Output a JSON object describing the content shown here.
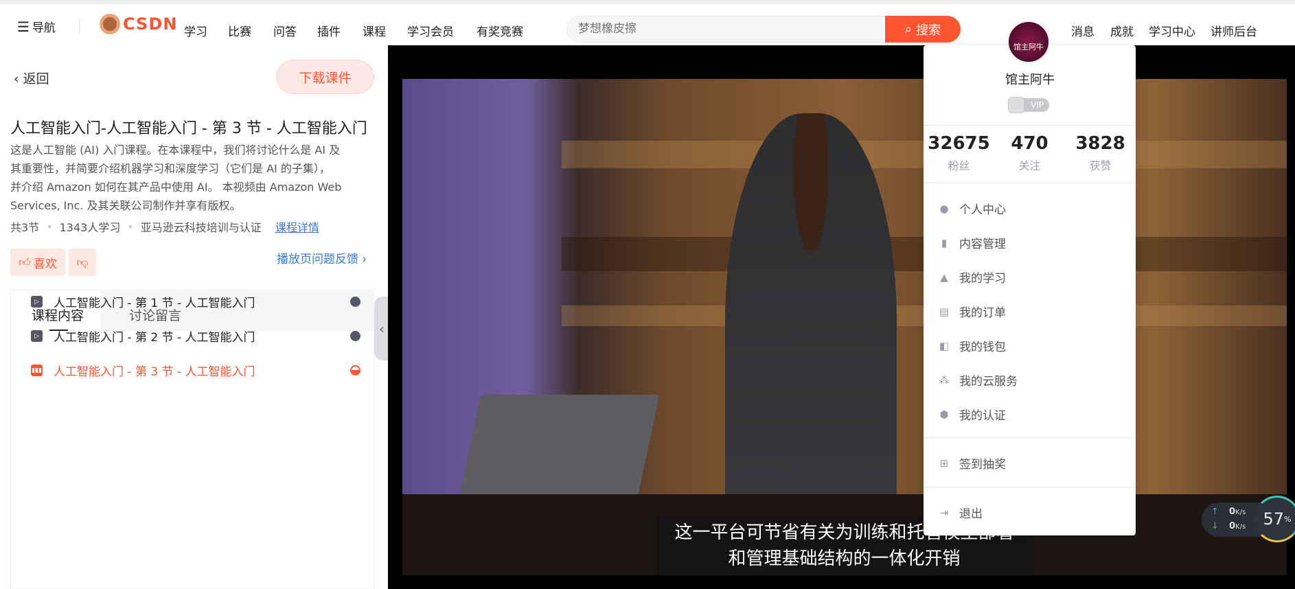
{
  "header": {
    "nav_label": "导航",
    "logo": "CSDN",
    "nav_items": [
      "学习",
      "比赛",
      "问答",
      "插件",
      "课程",
      "学习会员",
      "有奖竞赛"
    ],
    "search_placeholder": "梦想橡皮擦",
    "search_button": "搜索",
    "right_items": [
      "消息",
      "成就",
      "学习中心",
      "讲师后台"
    ]
  },
  "left": {
    "back": "返回",
    "download": "下载课件",
    "title": "人工智能入门-人工智能入门 - 第 3 节 - 人工智能入门",
    "description": [
      "这是人工智能 (AI) 入门课程。在本课程中，我们将讨论什么是 AI 及",
      "其重要性，并简要介绍机器学习和深度学习（它们是 AI 的子集），",
      "并介绍 Amazon 如何在其产品中使用 AI。 本视频由 Amazon Web",
      "Services, Inc. 及其关联公司制作并享有版权。"
    ],
    "meta": {
      "sections": "共3节",
      "learners": "1343人学习",
      "provider": "亚马逊云科技培训与认证",
      "details_link": "课程详情"
    },
    "like": "喜欢",
    "feedback": "播放页问题反馈",
    "tabs": [
      "课程内容",
      "讨论留言"
    ],
    "lessons": [
      {
        "title": "人工智能入门 - 第 1 节 - 人工智能入门",
        "status": "done"
      },
      {
        "title": "人工智能入门 - 第 2 节 - 人工智能入门",
        "status": "done"
      },
      {
        "title": "人工智能入门 - 第 3 节 - 人工智能入门",
        "status": "playing"
      }
    ]
  },
  "video": {
    "subtitle": [
      "这一平台可节省有关为训练和托管模型部署",
      "和管理基础结构的一体化开销"
    ]
  },
  "user_menu": {
    "avatar_text": "馆主阿牛",
    "name": "馆主阿牛",
    "vip": "VIP",
    "stats": [
      {
        "value": "32675",
        "label": "粉丝"
      },
      {
        "value": "470",
        "label": "关注"
      },
      {
        "value": "3828",
        "label": "获赞"
      }
    ],
    "items": [
      "个人中心",
      "内容管理",
      "我的学习",
      "我的订单",
      "我的钱包",
      "我的云服务",
      "我的认证"
    ],
    "sign_in": "签到抽奖",
    "logout": "退出"
  },
  "net_widget": {
    "upload": "0",
    "download": "0",
    "unit": "K/s",
    "cpu": "57",
    "cpu_unit": "%"
  },
  "colors": {
    "accent": "#fc5531",
    "link": "#3c7bd8"
  }
}
